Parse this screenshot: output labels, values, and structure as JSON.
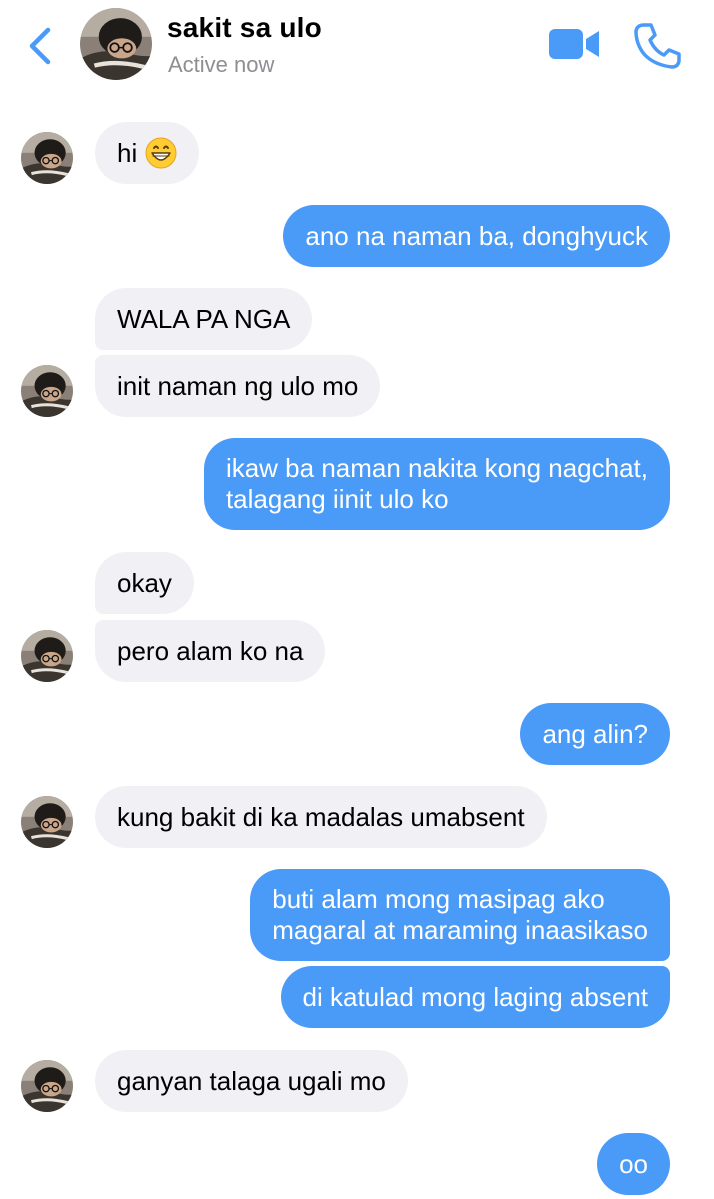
{
  "header": {
    "contact_name": "sakit sa ulo",
    "status": "Active now",
    "back_icon": "chevron-left-icon",
    "video_icon": "video-camera-icon",
    "call_icon": "phone-icon",
    "accent_color": "#4a9af8"
  },
  "messages": [
    {
      "from": "them",
      "text": "hi",
      "emoji": "grinning-face-icon"
    },
    {
      "from": "me",
      "text": "ano na naman ba, donghyuck"
    },
    {
      "from": "them",
      "text": "WALA PA NGA"
    },
    {
      "from": "them",
      "text": "init naman ng ulo mo"
    },
    {
      "from": "me",
      "text": "ikaw ba naman nakita kong nagchat,",
      "text2": "talagang iinit ulo ko"
    },
    {
      "from": "them",
      "text": "okay"
    },
    {
      "from": "them",
      "text": "pero alam ko na"
    },
    {
      "from": "me",
      "text": "ang alin?"
    },
    {
      "from": "them",
      "text": "kung bakit di ka madalas umabsent"
    },
    {
      "from": "me",
      "text": "buti alam mong masipag ako",
      "text2": "magaral at maraming inaasikaso"
    },
    {
      "from": "me",
      "text": "di katulad mong laging absent"
    },
    {
      "from": "them",
      "text": "ganyan talaga ugali mo"
    },
    {
      "from": "me",
      "text": "oo"
    }
  ],
  "colors": {
    "outgoing_bubble": "#4a9af8",
    "incoming_bubble": "#f1f0f5",
    "status_text": "#8e8e93"
  }
}
